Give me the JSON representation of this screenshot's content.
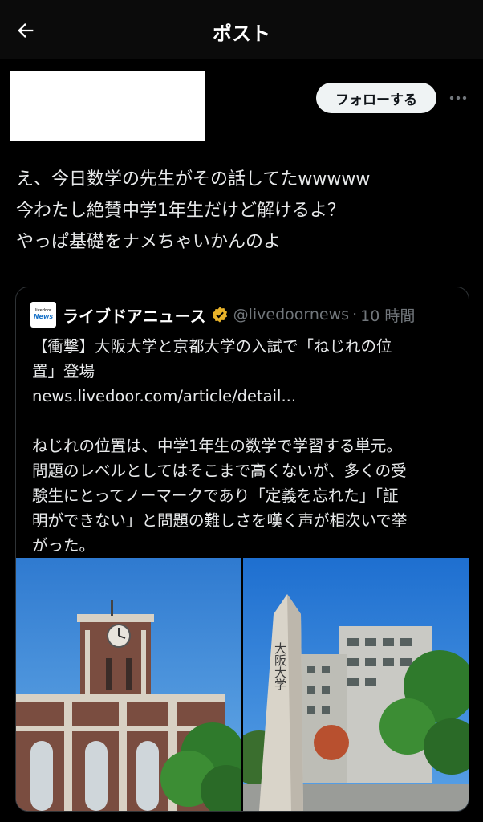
{
  "header": {
    "title": "ポスト",
    "back_icon": "arrow-left-icon"
  },
  "author": {
    "follow_label": "フォローする",
    "more_icon": "more-horizontal-icon"
  },
  "post": {
    "lines": [
      "え、今日数学の先生がその話してたwwwww",
      "今わたし絶賛中学1年生だけど解けるよ？",
      "やっぱ基礎をナメちゃいかんのよ"
    ]
  },
  "quoted": {
    "avatar_text_top": "livedoor",
    "avatar_text_bottom": "News",
    "name": "ライブドアニュース",
    "handle": "@livedoornews",
    "separator": "·",
    "time": "10 時間",
    "headline_lines": [
      "【衝撃】大阪大学と京都大学の入試で「ねじれの位",
      "置」登場"
    ],
    "link": "news.livedoor.com/article/detail...",
    "body_lines": [
      "ねじれの位置は、中学1年生の数学で学習する単元。",
      "問題のレベルとしてはそこまで高くないが、多くの受",
      "験生にとってノーマークであり「定義を忘れた」「証",
      "明ができない」と問題の難しさを嘆く声が相次いで挙",
      "がった。"
    ],
    "stone_text": "大阪大学",
    "colors": {
      "verified": "#e8b22a",
      "sky": "#3f86d6",
      "brick": "#7a4d40"
    }
  }
}
